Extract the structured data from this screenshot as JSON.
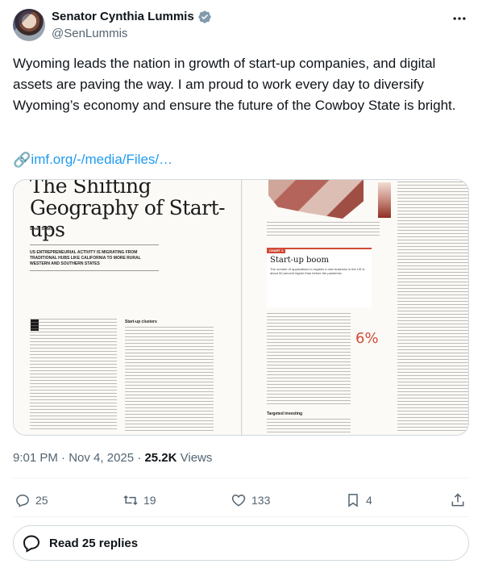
{
  "author": {
    "display_name": "Senator Cynthia Lummis",
    "handle": "@SenLummis",
    "verified_badge_color": "#829aab"
  },
  "tweet": {
    "text": "Wyoming leads the nation in growth of start-up companies, and digital assets are paving the way. I am proud to work every day to diversify Wyoming’s economy and ensure the future of the Cowboy State is bright.",
    "link_text": "imf.org/-/media/Files/…"
  },
  "media": {
    "title_line1": "The Shifting",
    "title_line2": "Geography of Start-ups",
    "byline": "Swati Bhatt",
    "deck": "US entrepreneurial activity is migrating from traditional hubs like California to more rural western and southern states",
    "subhead_left": "Start-up clusters",
    "chart_tag": "CHART 2",
    "chart_title": "Start-up boom",
    "chart_subtitle": "The number of applications to register a new business in the US is about 50 percent higher than before the pandemic.",
    "stat_value": "6%",
    "subhead_bottom": "Targeted investing"
  },
  "meta": {
    "time": "9:01 PM",
    "separator": " · ",
    "date": "Nov 4, 2025",
    "views_count": "25.2K",
    "views_label": " Views"
  },
  "actions": {
    "replies": "25",
    "reposts": "19",
    "likes": "133",
    "bookmarks": "4"
  },
  "replies_button": {
    "label": "Read 25 replies"
  },
  "colors": {
    "accent_link": "#1d9bf0",
    "secondary_text": "#536471",
    "chart_red": "#d24a36"
  }
}
